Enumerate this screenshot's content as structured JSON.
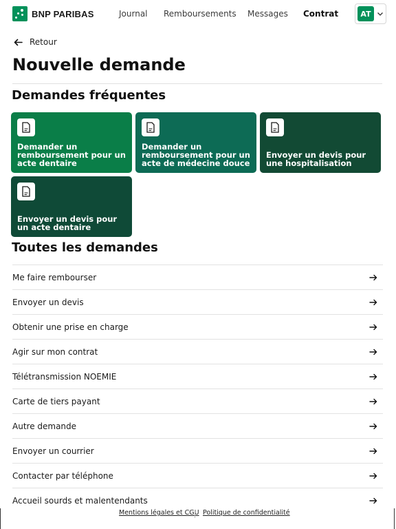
{
  "header": {
    "brand": "BNP PARIBAS",
    "nav": [
      {
        "label": "Journal"
      },
      {
        "label": "Remboursements"
      },
      {
        "label": "Messages"
      },
      {
        "label": "Contrat"
      }
    ],
    "avatar_initials": "AT"
  },
  "back_label": "Retour",
  "page_title": "Nouvelle demande",
  "frequent": {
    "title": "Demandes fréquentes",
    "cards": [
      {
        "label": "Demander un remboursement pour un acte dentaire"
      },
      {
        "label": "Demander un remboursement pour un acte de médecine douce"
      },
      {
        "label": "Envoyer un devis pour une hospitalisation"
      },
      {
        "label": "Envoyer un devis pour un acte dentaire"
      }
    ]
  },
  "all": {
    "title": "Toutes les demandes",
    "items": [
      {
        "label": "Me faire rembourser"
      },
      {
        "label": "Envoyer un devis"
      },
      {
        "label": "Obtenir une prise en charge"
      },
      {
        "label": "Agir sur mon contrat"
      },
      {
        "label": "Télétransmission NOEMIE"
      },
      {
        "label": "Carte de tiers payant"
      },
      {
        "label": "Autre demande"
      },
      {
        "label": "Envoyer un courrier"
      },
      {
        "label": "Contacter par téléphone"
      },
      {
        "label": "Accueil sourds et malentendants"
      }
    ]
  },
  "footer": {
    "legal": "Mentions légales et CGU",
    "privacy": "Politique de confidentialité"
  },
  "colors": {
    "brand_green": "#00915a",
    "card_1": "#0a7e48",
    "card_2": "#0d6b55",
    "card_3": "#124a34",
    "card_4": "#0f4a37"
  }
}
